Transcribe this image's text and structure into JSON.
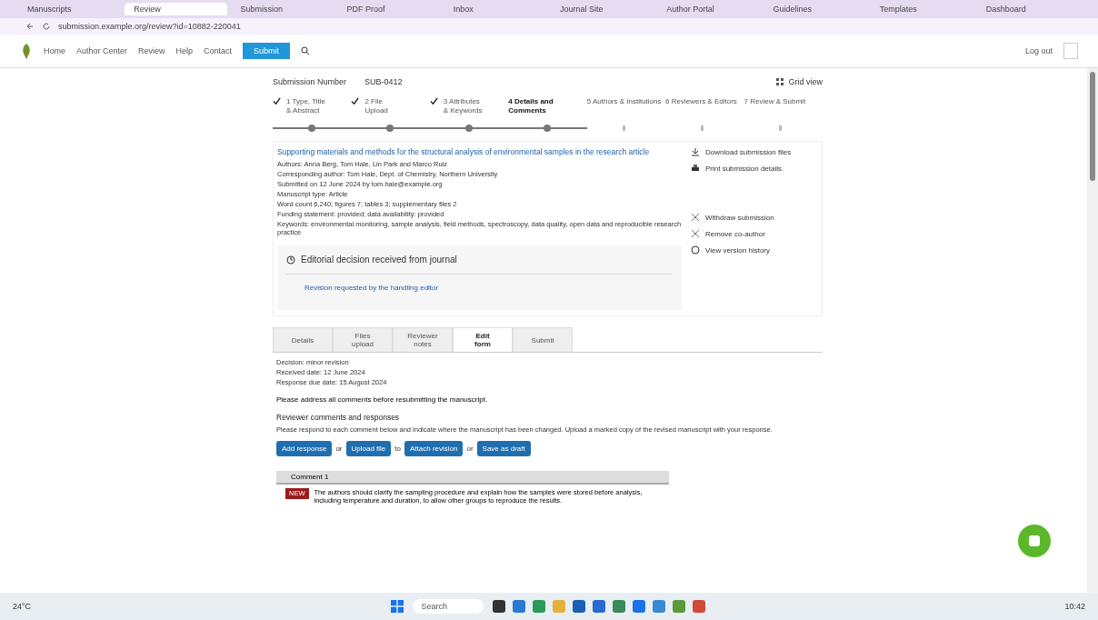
{
  "browser": {
    "tabs": [
      {
        "label": "Manuscripts",
        "selected": false
      },
      {
        "label": "Review",
        "selected": true
      },
      {
        "label": "Submission",
        "selected": false
      },
      {
        "label": "PDF Proof",
        "selected": false
      },
      {
        "label": "Inbox",
        "selected": false
      },
      {
        "label": "Journal Site",
        "selected": false
      },
      {
        "label": "Author Portal",
        "selected": false
      },
      {
        "label": "Guidelines",
        "selected": false
      },
      {
        "label": "Templates",
        "selected": false
      },
      {
        "label": "Dashboard",
        "selected": false
      }
    ],
    "url": "submission.example.org/review?id=10882-220041"
  },
  "site": {
    "nav": [
      "Home",
      "Author Center",
      "Review",
      "Help",
      "Contact"
    ],
    "primary_button": "Submit",
    "account": "Log out"
  },
  "submission": {
    "number_label": "Submission Number",
    "number": "SUB-0412",
    "layout_label": "Grid view"
  },
  "steps": [
    {
      "label": "1 Type, Title",
      "sub": "& Abstract",
      "done": true,
      "current": false
    },
    {
      "label": "2 File",
      "sub": "Upload",
      "done": true,
      "current": false
    },
    {
      "label": "3 Attributes",
      "sub": "& Keywords",
      "done": true,
      "current": false
    },
    {
      "label": "4 Details and",
      "sub": "Comments",
      "done": false,
      "current": true
    },
    {
      "label": "5 Authors & Institutions",
      "done": false,
      "current": false
    },
    {
      "label": "6 Reviewers & Editors",
      "done": false,
      "current": false
    },
    {
      "label": "7 Review & Submit",
      "done": false,
      "current": false
    }
  ],
  "summary": {
    "title": "Supporting materials and methods for the structural analysis of environmental samples in the research article",
    "lines": [
      "Authors: Anna Berg, Tom Hale, Lin Park and Marco Ruiz",
      "Corresponding author: Tom Hale, Dept. of Chemistry, Northern University",
      "Submitted on 12 June 2024 by tom.hale@example.org",
      "Manuscript type: Article",
      "Word count 6,240; figures 7; tables 3; supplementary files 2",
      "Funding statement: provided; data availability: provided",
      "Keywords: environmental monitoring, sample analysis, field methods, spectroscopy, data quality, open data and reproducible research practice"
    ],
    "actions": [
      {
        "kind": "download",
        "label": "Download submission files"
      },
      {
        "kind": "print",
        "label": "Print submission details"
      },
      {
        "kind": "close",
        "label": "Withdraw submission"
      },
      {
        "kind": "close",
        "label": "Remove co-author"
      },
      {
        "kind": "history",
        "label": "View version history"
      }
    ],
    "notice": {
      "title": "Editorial decision received from journal",
      "line": "Revision requested by the handling editor"
    }
  },
  "tabs": [
    {
      "label": "Details",
      "selected": false
    },
    {
      "label": "Files",
      "sub": "upload",
      "selected": false
    },
    {
      "label": "Reviewer",
      "sub": "notes",
      "selected": false
    },
    {
      "label": "Edit",
      "sub": "form",
      "selected": true
    },
    {
      "label": "Submit",
      "selected": false
    }
  ],
  "details": {
    "lines": [
      "Decision: minor revision",
      "Received date: 12 June 2024",
      "Response due date: 15 August 2024"
    ],
    "note": "Please address all comments before resubmitting the manuscript.",
    "heading": "Reviewer comments and responses",
    "para": "Please respond to each comment below and indicate where the manuscript has been changed. Upload a marked copy of the revised manuscript with your response.",
    "buttons": [
      {
        "label": "Add response",
        "sep": "or"
      },
      {
        "label": "Upload file",
        "sep": "to"
      },
      {
        "label": "Attach revision",
        "sep": "or"
      },
      {
        "label": "Save as draft"
      }
    ],
    "panel_title": "Comment 1",
    "badge": "NEW",
    "comment": "The authors should clarify the sampling procedure and explain how the samples were stored before analysis, including temperature and duration, to allow other groups to reproduce the results."
  },
  "taskbar": {
    "weather": "24°C",
    "search": "Search",
    "time": "10:42"
  }
}
